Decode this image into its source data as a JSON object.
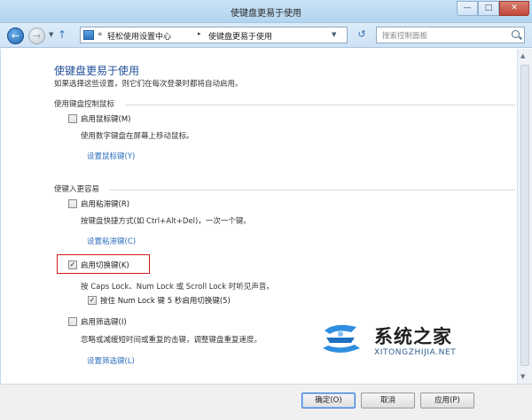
{
  "window": {
    "title": "使键盘更易于使用",
    "min_glyph": "—",
    "max_glyph": "□",
    "close_glyph": "✕"
  },
  "nav": {
    "back_glyph": "←",
    "forward_glyph": "→",
    "up_glyph": "↑",
    "breadcrumb_chevron": "«",
    "breadcrumb": [
      "轻松使用设置中心",
      "使键盘更易于使用"
    ],
    "separator": "▸",
    "refresh_glyph": "↺",
    "search_placeholder": "搜索控制面板"
  },
  "page": {
    "title": "使键盘更易于使用",
    "description": "如果选择这些设置，则它们在每次登录时都将自动启用。"
  },
  "section_mouse": {
    "heading": "使用键盘控制鼠标",
    "mouse_keys": {
      "label": "启用鼠标键(M)",
      "checked": false,
      "description": "使用数字键盘在屏幕上移动鼠标。",
      "link": "设置鼠标键(Y)"
    }
  },
  "section_typing": {
    "heading": "使键入更容易",
    "sticky_keys": {
      "label": "启用粘滞键(R)",
      "checked": false,
      "description": "按键盘快捷方式(如 Ctrl+Alt+Del)，一次一个键。",
      "link": "设置粘滞键(C)"
    },
    "toggle_keys": {
      "label": "启用切换键(K)",
      "checked": true,
      "description": "按 Caps Lock、Num Lock 或 Scroll Lock 时听见声音。",
      "sub_option": {
        "label": "按住 Num Lock 键 5 秒启用切换键(5)",
        "checked": true
      }
    },
    "filter_keys": {
      "label": "启用筛选键(I)",
      "checked": false,
      "description": "忽略或减缓短时间或重复的击键，调整键盘重复速度。",
      "link": "设置筛选键(L)"
    }
  },
  "buttons": {
    "ok": "确定(O)",
    "cancel": "取消",
    "apply": "应用(P)"
  },
  "check_glyph": "✓",
  "watermark": {
    "brand": "系统之家",
    "site": "XITONGZHIJIA.NET"
  },
  "colors": {
    "accent": "#1f4f9a",
    "link": "#2a6ebd",
    "highlight_border": "#d0191f"
  }
}
